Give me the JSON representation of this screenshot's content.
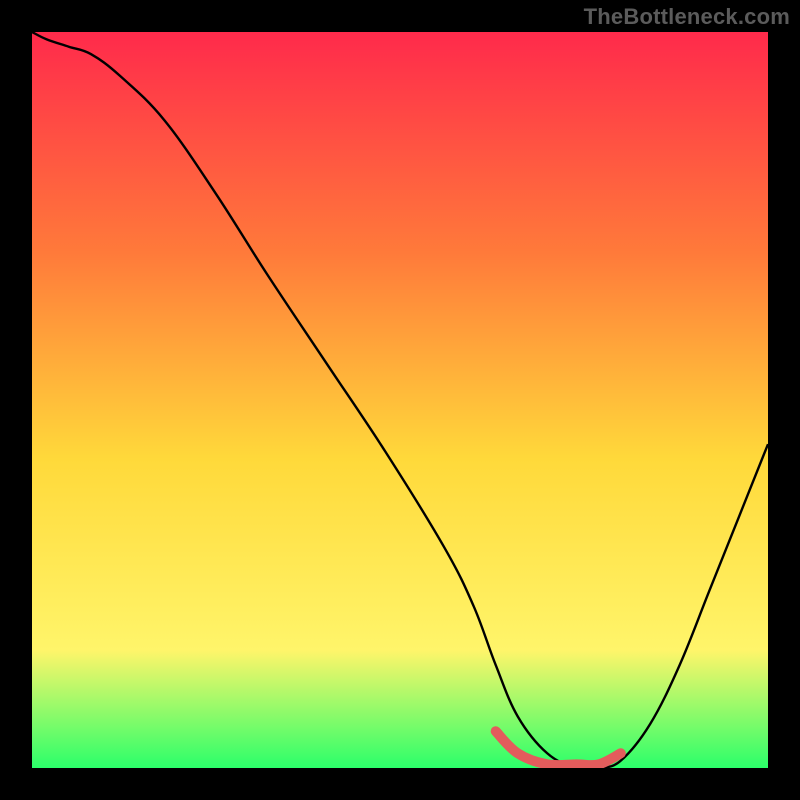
{
  "watermark": "TheBottleneck.com",
  "chart_data": {
    "type": "line",
    "title": "",
    "xlabel": "",
    "ylabel": "",
    "xlim": [
      0,
      100
    ],
    "ylim": [
      0,
      100
    ],
    "background_gradient": {
      "top": "#ff2a4b",
      "mid_upper": "#ff7a3a",
      "mid": "#ffd93a",
      "mid_lower": "#fff56a",
      "bottom": "#2bff6a"
    },
    "x": [
      0,
      2,
      5,
      8,
      12,
      18,
      25,
      32,
      40,
      48,
      56,
      60,
      63,
      66,
      70,
      74,
      77,
      80,
      84,
      88,
      92,
      96,
      100
    ],
    "series": [
      {
        "name": "bottleneck-curve",
        "color": "#000000",
        "values": [
          100,
          99,
          98,
          97,
          94,
          88,
          78,
          67,
          55,
          43,
          30,
          22,
          14,
          7,
          2,
          0,
          0,
          1,
          6,
          14,
          24,
          34,
          44
        ]
      }
    ],
    "highlight_segment": {
      "name": "optimal-range",
      "color": "#e35c5c",
      "x": [
        63,
        66,
        70,
        74,
        77,
        80
      ],
      "values": [
        5,
        2,
        0.5,
        0.5,
        0.5,
        2
      ]
    }
  }
}
